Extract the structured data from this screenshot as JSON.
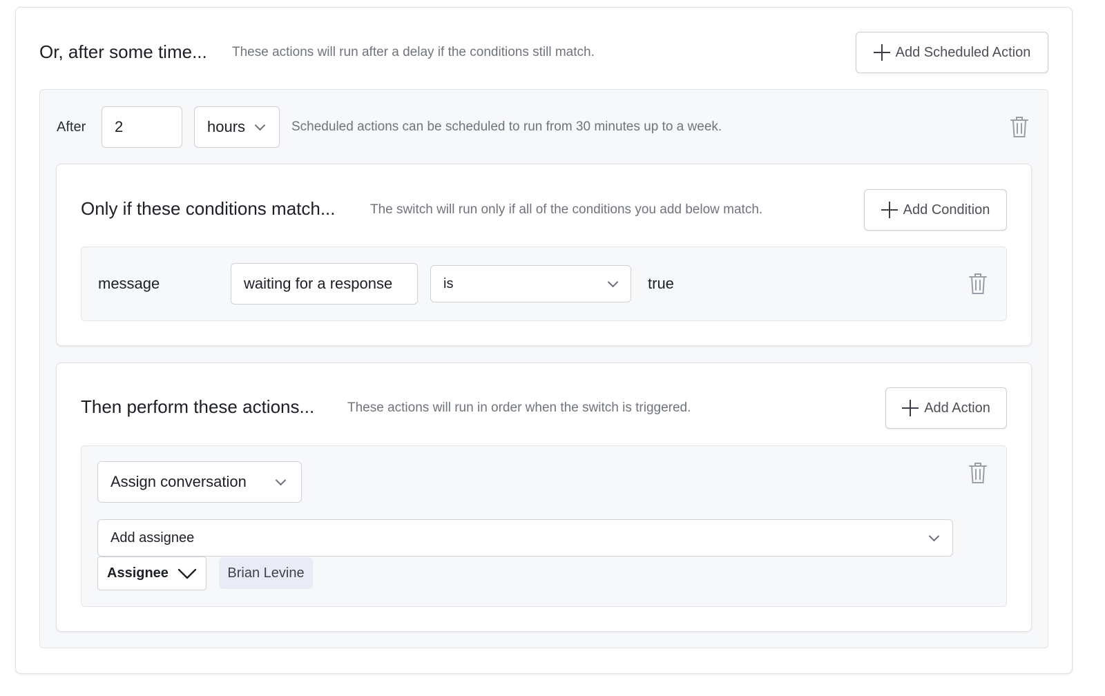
{
  "scheduled": {
    "title": "Or, after some time...",
    "description": "These actions will run after a delay if the conditions still match.",
    "add_button_label": "Add Scheduled Action",
    "after_label": "After",
    "delay_value": "2",
    "delay_unit": "hours",
    "hint": "Scheduled actions can be scheduled to run from 30 minutes up to a week."
  },
  "conditions": {
    "title": "Only if these conditions match...",
    "description": "The switch will run only if all of the conditions you add below match.",
    "add_button_label": "Add Condition",
    "row": {
      "subject": "message",
      "property": "waiting for a response",
      "operator": "is",
      "value": "true"
    }
  },
  "actions": {
    "title": "Then perform these actions...",
    "description": "These actions will run in order when the switch is triggered.",
    "add_button_label": "Add Action",
    "action_type": "Assign conversation",
    "assignee_placeholder": "Add assignee",
    "assignee_type": "Assignee",
    "assignee_name": "Brian Levine"
  },
  "icons": {
    "add": "plus-icon",
    "delete": "trash-icon",
    "dropdown": "chevron-down-icon"
  }
}
